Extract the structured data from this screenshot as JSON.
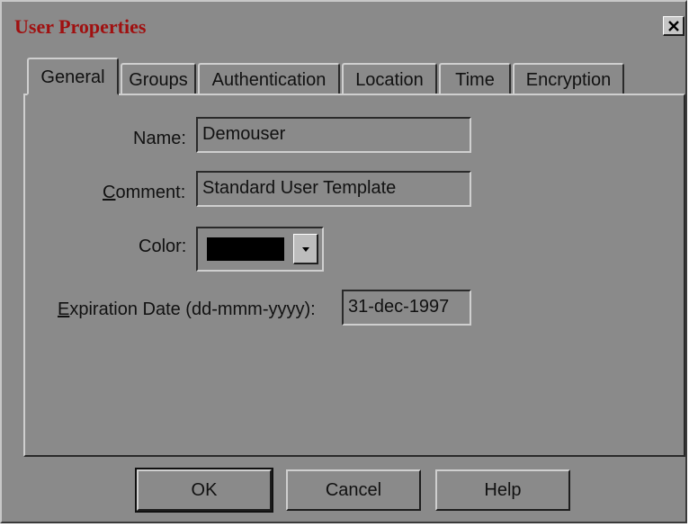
{
  "dialog": {
    "title": "User Properties",
    "close_glyph": "✕"
  },
  "tabs": [
    {
      "label": "General",
      "active": true
    },
    {
      "label": "Groups",
      "active": false
    },
    {
      "label": "Authentication",
      "active": false
    },
    {
      "label": "Location",
      "active": false
    },
    {
      "label": "Time",
      "active": false
    },
    {
      "label": "Encryption",
      "active": false
    }
  ],
  "general": {
    "name_label": "Name:",
    "name_value": "Demouser",
    "comment_label_first": "C",
    "comment_label_rest": "omment:",
    "comment_value": "Standard User Template",
    "color_label": "Color:",
    "color_value": "#000000",
    "expiration_label_first": "E",
    "expiration_label_rest": "xpiration Date (dd-mmm-yyyy):",
    "expiration_value": "31-dec-1997"
  },
  "buttons": {
    "ok": "OK",
    "cancel": "Cancel",
    "help": "Help"
  },
  "icons": {
    "close": "close-icon",
    "dropdown": "dropdown-arrow-icon"
  }
}
